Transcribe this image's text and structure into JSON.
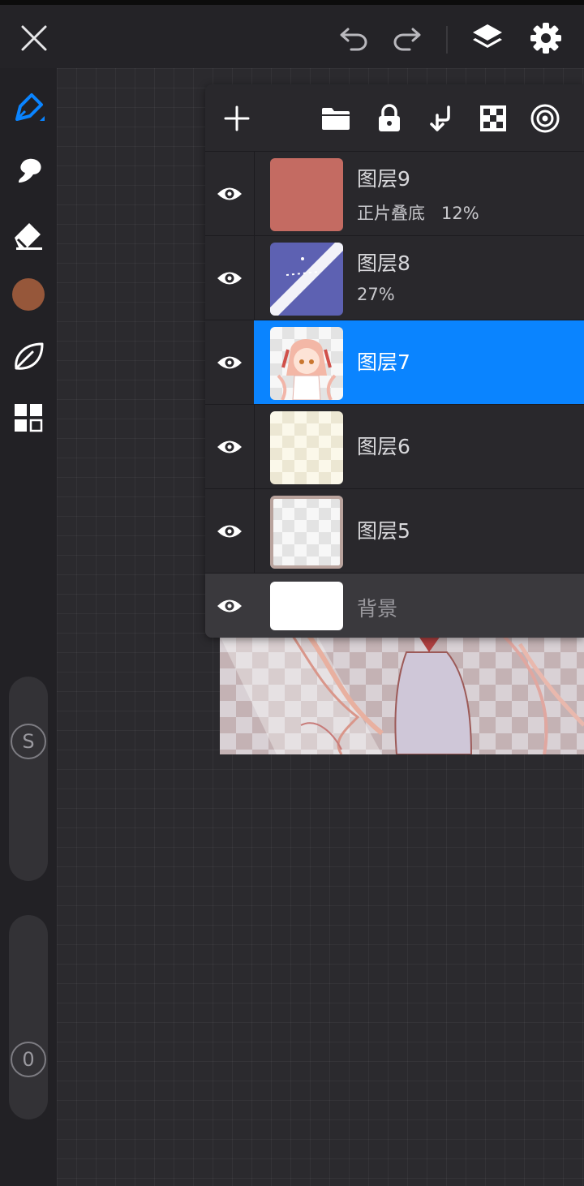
{
  "topbar": {
    "icons": [
      "close-icon",
      "undo-icon",
      "redo-icon",
      "layers-icon",
      "settings-icon"
    ]
  },
  "colors": {
    "accent": "#0a84ff",
    "current_color": "#96573a",
    "layer9_fill": "#c46b62",
    "layer8_fill": "#5d61b2"
  },
  "left_toolbar": {
    "tools": [
      "pen-icon",
      "smudge-icon",
      "eraser-icon",
      "color-swatch",
      "leaf-icon",
      "grid-icon"
    ],
    "size_slider_label": "S",
    "opacity_slider_label": "0"
  },
  "layer_panel": {
    "toolbar_icons": [
      "add-icon",
      "folder-icon",
      "lock-icon",
      "merge-down-icon",
      "checker-icon",
      "target-icon"
    ],
    "layers": [
      {
        "name": "图层9",
        "meta": "正片叠底   12%"
      },
      {
        "name": "图层8",
        "meta": "27%"
      },
      {
        "name": "图层7",
        "meta": ""
      },
      {
        "name": "图层6",
        "meta": ""
      },
      {
        "name": "图层5",
        "meta": ""
      },
      {
        "name": "背景",
        "meta": ""
      }
    ]
  }
}
